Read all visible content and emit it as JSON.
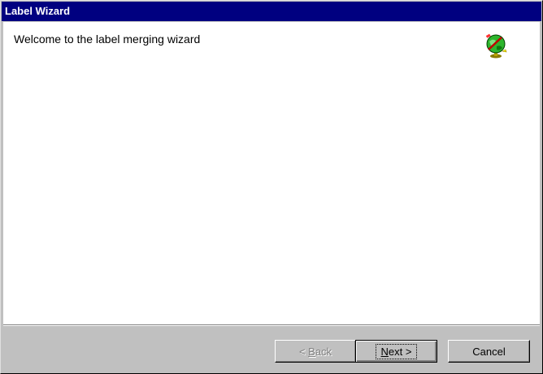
{
  "window": {
    "title": "Label Wizard"
  },
  "content": {
    "welcome_text": "Welcome to the label merging wizard",
    "icon": "globe-wand-icon"
  },
  "buttons": {
    "back": {
      "arrow": "<",
      "accel": "B",
      "rest": "ack",
      "enabled": false
    },
    "next": {
      "accel": "N",
      "rest": "ext",
      "arrow": ">",
      "default": true
    },
    "cancel": {
      "label": "Cancel"
    }
  },
  "colors": {
    "titlebar": "#000080",
    "face": "#c0c0c0",
    "content_bg": "#ffffff"
  }
}
